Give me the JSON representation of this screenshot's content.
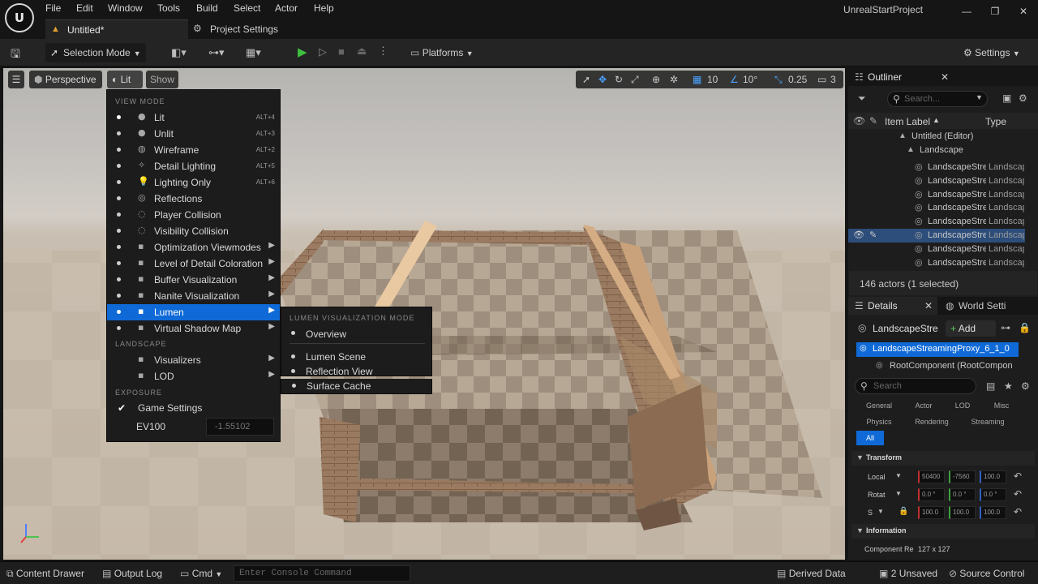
{
  "menubar": {
    "items": [
      "File",
      "Edit",
      "Window",
      "Tools",
      "Build",
      "Select",
      "Actor",
      "Help"
    ]
  },
  "tabs": [
    {
      "label": "Untitled*"
    },
    {
      "label": "Project Settings"
    }
  ],
  "project_name": "UnrealStartProject",
  "logo_text": "U",
  "toolbar": {
    "selection_mode": "Selection Mode",
    "platforms": "Platforms",
    "settings": "Settings"
  },
  "viewport": {
    "perspective": "Perspective",
    "lit": "Lit",
    "show": "Show",
    "grid_snap": "10",
    "rot_snap": "10°",
    "scale_snap": "0.25",
    "camera_speed": "3"
  },
  "lit_menu": {
    "section_view_mode": "VIEW MODE",
    "items": [
      {
        "label": "Lit",
        "shortcut": "ALT+4",
        "icon": "sphere-icon",
        "selected": true
      },
      {
        "label": "Unlit",
        "shortcut": "ALT+3",
        "icon": "sphere-icon"
      },
      {
        "label": "Wireframe",
        "shortcut": "ALT+2",
        "icon": "wireframe-icon"
      },
      {
        "label": "Detail Lighting",
        "shortcut": "ALT+5",
        "icon": "light-icon"
      },
      {
        "label": "Lighting Only",
        "shortcut": "ALT+6",
        "icon": "bulb-icon"
      },
      {
        "label": "Reflections",
        "shortcut": "",
        "icon": "reflection-icon"
      },
      {
        "label": "Player Collision",
        "shortcut": "",
        "icon": "collision-icon"
      },
      {
        "label": "Visibility Collision",
        "shortcut": "",
        "icon": "collision-icon"
      },
      {
        "label": "Optimization Viewmodes",
        "shortcut": "",
        "icon": "grid-icon",
        "submenu": true
      },
      {
        "label": "Level of Detail Coloration",
        "shortcut": "",
        "icon": "grid-icon",
        "submenu": true
      },
      {
        "label": "Buffer Visualization",
        "shortcut": "",
        "icon": "buffer-icon",
        "submenu": true
      },
      {
        "label": "Nanite Visualization",
        "shortcut": "",
        "icon": "buffer-icon",
        "submenu": true
      },
      {
        "label": "Lumen",
        "shortcut": "",
        "icon": "buffer-icon",
        "submenu": true,
        "highlighted": true
      },
      {
        "label": "Virtual Shadow Map",
        "shortcut": "",
        "icon": "buffer-icon",
        "submenu": true
      }
    ],
    "section_landscape": "LANDSCAPE",
    "landscape_items": [
      {
        "label": "Visualizers",
        "submenu": true
      },
      {
        "label": "LOD",
        "submenu": true
      }
    ],
    "section_exposure": "EXPOSURE",
    "game_settings": "Game Settings",
    "ev100_label": "EV100",
    "ev100_value": "-1.55102"
  },
  "lumen_submenu": {
    "header": "LUMEN VISUALIZATION MODE",
    "items": [
      "Overview",
      "Lumen Scene",
      "Reflection View",
      "Surface Cache"
    ]
  },
  "outliner": {
    "title": "Outliner",
    "search_placeholder": "Search...",
    "col_label": "Item Label",
    "col_type": "Type",
    "world": "Untitled (Editor)",
    "landscape": "Landscape",
    "rows": [
      {
        "label": "LandscapeStreamingProxy",
        "type": "Landscape"
      },
      {
        "label": "LandscapeStreamingProxy",
        "type": "Landscape"
      },
      {
        "label": "LandscapeStreamingProxy",
        "type": "Landscape"
      },
      {
        "label": "LandscapeStreamingProxy",
        "type": "Landscape"
      },
      {
        "label": "LandscapeStreamingProxy",
        "type": "Landscape"
      },
      {
        "label": "LandscapeStreamingProxy",
        "type": "Landscape",
        "selected": true
      },
      {
        "label": "LandscapeStreamingProxy",
        "type": "Landscape"
      },
      {
        "label": "LandscapeStreamingProxy",
        "type": "Landscape"
      }
    ],
    "status": "146 actors (1 selected)"
  },
  "details": {
    "tab_details": "Details",
    "tab_world": "World Setti",
    "actor_name": "LandscapeStre",
    "add_label": "Add",
    "component_selected": "LandscapeStreamingProxy_6_1_0",
    "root_component": "RootComponent (RootCompon",
    "search_placeholder": "Search",
    "categories": [
      "General",
      "Actor",
      "LOD",
      "Misc",
      "Physics",
      "Rendering",
      "Streaming",
      "All"
    ],
    "transform_header": "Transform",
    "location_label": "Local",
    "location": [
      "50400",
      "-7560",
      "100.0"
    ],
    "rotation_label": "Rotat",
    "rotation": [
      "0.0 °",
      "0.0 °",
      "0.0 °"
    ],
    "scale_label": "S",
    "scale": [
      "100.0",
      "100.0",
      "100.0"
    ],
    "information_header": "Information",
    "component_res_label": "Component Re",
    "component_res_value": "127 x 127"
  },
  "statusbar": {
    "content_drawer": "Content Drawer",
    "output_log": "Output Log",
    "cmd": "Cmd",
    "console_placeholder": "Enter Console Command",
    "derived_data": "Derived Data",
    "unsaved": "2 Unsaved",
    "source_control": "Source Control"
  }
}
